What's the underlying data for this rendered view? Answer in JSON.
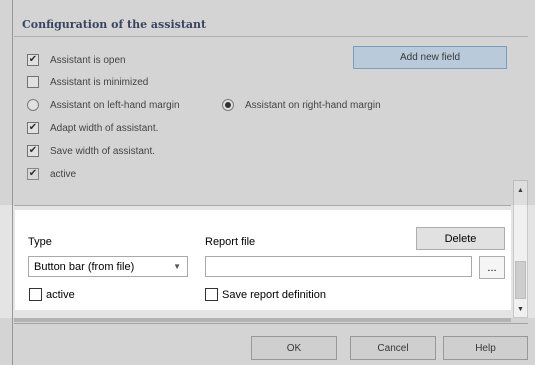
{
  "config": {
    "title": "Configuration of the assistant",
    "options": [
      {
        "label": "Assistant is open",
        "type": "checkbox",
        "checked": true
      },
      {
        "label": "Assistant is minimized",
        "type": "checkbox",
        "checked": false
      },
      {
        "label": "Adapt width of assistant.",
        "type": "checkbox",
        "checked": true
      },
      {
        "label": "Save width of assistant.",
        "type": "checkbox",
        "checked": true
      },
      {
        "label": "active",
        "type": "checkbox",
        "checked": true
      }
    ],
    "margin_left_label": "Assistant on left-hand margin",
    "margin_right_label": "Assistant on right-hand margin",
    "margin_selected": "right",
    "add_field_label": "Add new field"
  },
  "field": {
    "type_label": "Type",
    "type_value": "Button bar (from file)",
    "report_file_label": "Report file",
    "report_file_value": "",
    "browse_label": "...",
    "delete_label": "Delete",
    "active_label": "active",
    "active_checked": false,
    "save_report_label": "Save report definition",
    "save_report_checked": false
  },
  "footer": {
    "ok_label": "OK",
    "cancel_label": "Cancel",
    "help_label": "Help"
  },
  "colors": {
    "title": "#2a3a57",
    "accent_button": "#c4d9ec"
  }
}
